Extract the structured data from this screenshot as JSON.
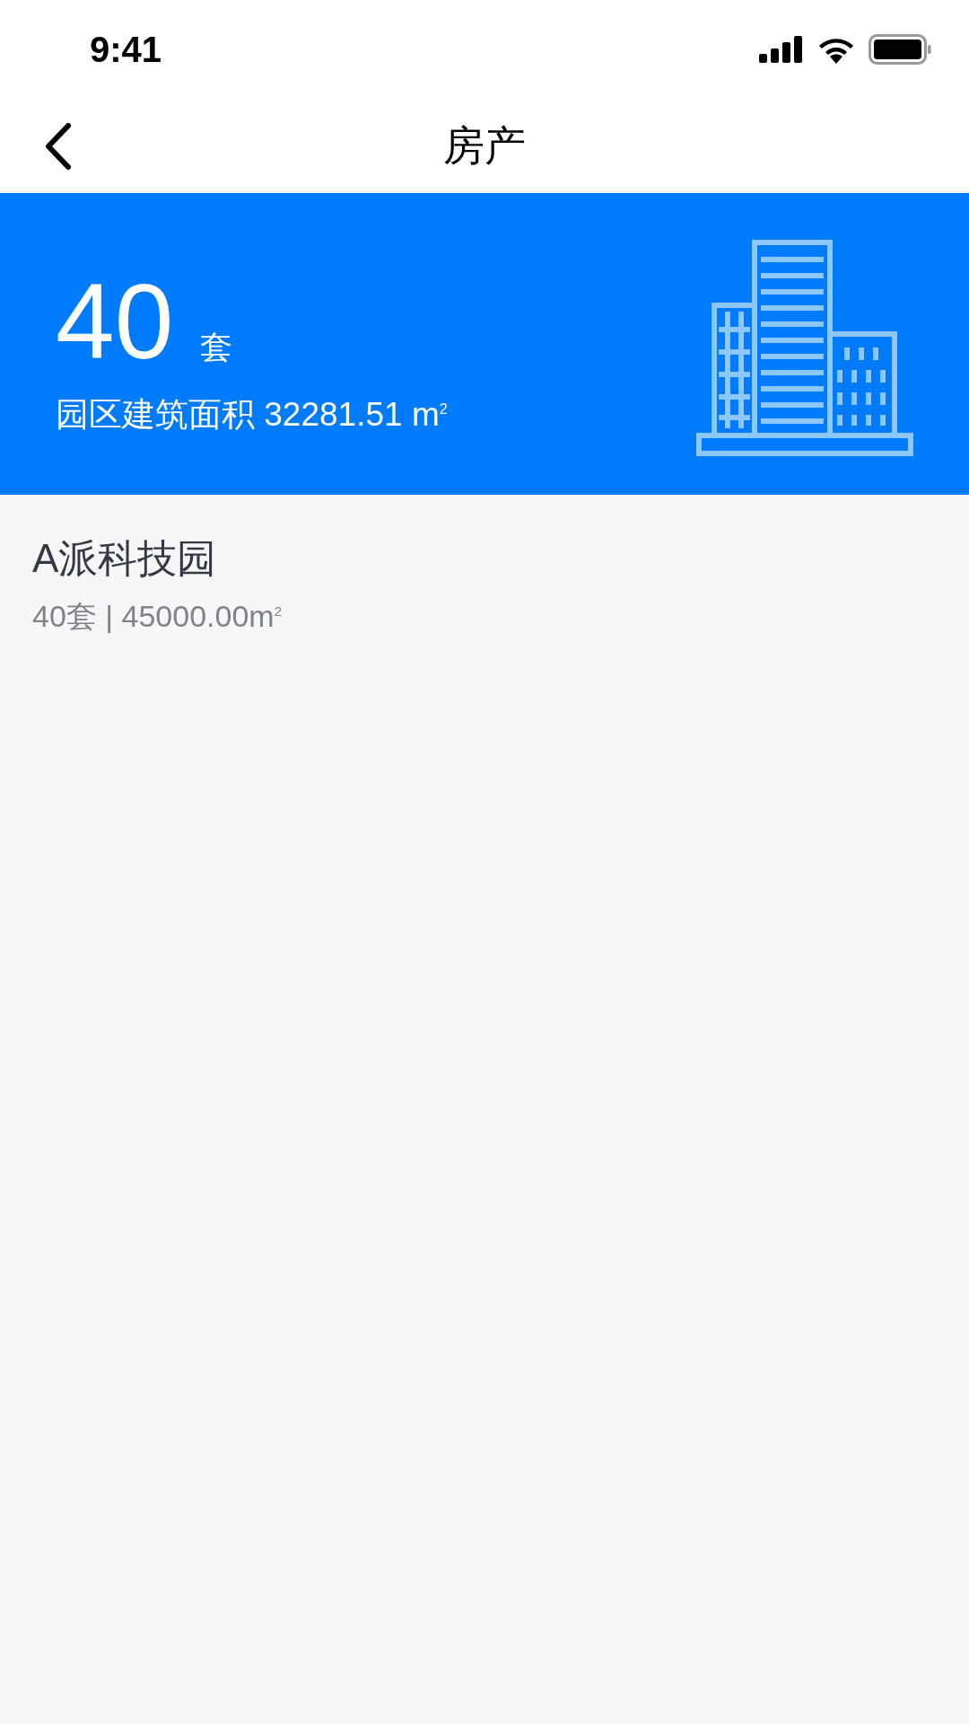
{
  "status_bar": {
    "time": "9:41"
  },
  "nav": {
    "title": "房产"
  },
  "summary": {
    "count": "40",
    "unit": "套",
    "area_label": "园区建筑面积 32281.51 m$^{2}$"
  },
  "parks": [
    {
      "name": "A派科技园",
      "detail": "40套 | 45000.00m$^{2}$"
    }
  ]
}
